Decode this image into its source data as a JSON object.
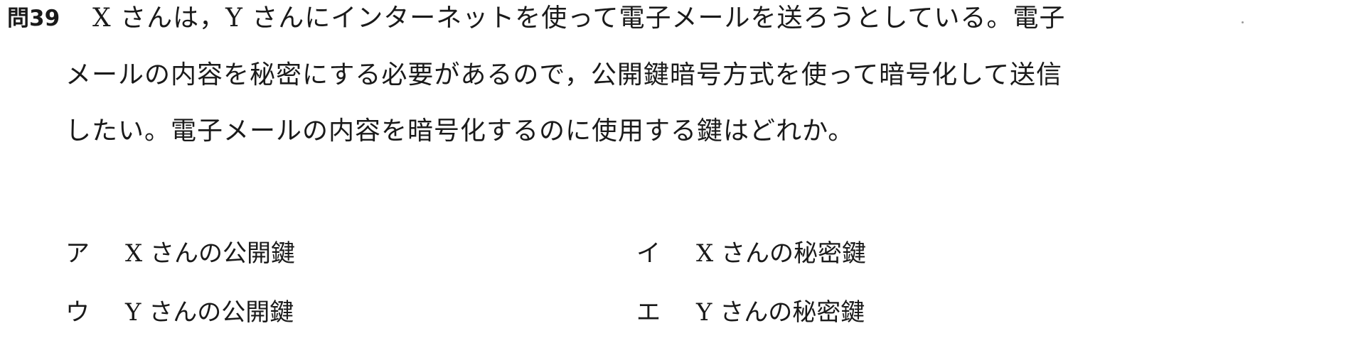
{
  "question": {
    "number": "問39",
    "lines": [
      "X さんは，Y さんにインターネットを使って電子メールを送ろうとしている。電子",
      "メールの内容を秘密にする必要があるので，公開鍵暗号方式を使って暗号化して送信",
      "したい。電子メールの内容を暗号化するのに使用する鍵はどれか。"
    ]
  },
  "choices": [
    {
      "label": "ア",
      "text": "X さんの公開鍵"
    },
    {
      "label": "イ",
      "text": "X さんの秘密鍵"
    },
    {
      "label": "ウ",
      "text": "Y さんの公開鍵"
    },
    {
      "label": "エ",
      "text": "Y さんの秘密鍵"
    }
  ]
}
